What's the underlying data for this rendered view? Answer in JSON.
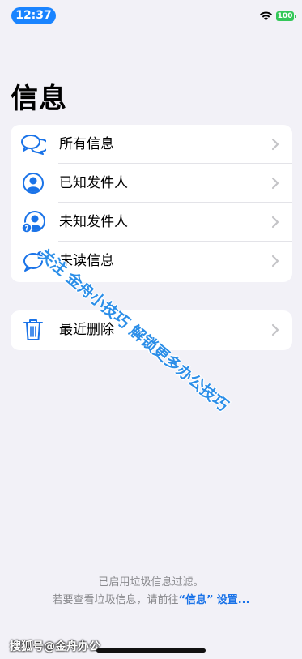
{
  "status": {
    "time": "12:37",
    "battery": "100"
  },
  "page": {
    "title": "信息"
  },
  "filters": [
    {
      "label": "所有信息",
      "icon": "speech-bubbles-icon"
    },
    {
      "label": "已知发件人",
      "icon": "person-circle-icon"
    },
    {
      "label": "未知发件人",
      "icon": "person-question-icon"
    },
    {
      "label": "未读信息",
      "icon": "unread-bubble-icon"
    }
  ],
  "recently_deleted": {
    "label": "最近删除",
    "icon": "trash-icon"
  },
  "footer": {
    "line1": "已启用垃圾信息过滤。",
    "line2_prefix": "若要查看垃圾信息，请前往",
    "line2_link": "“信息”",
    "line2_suffix": "设置..."
  },
  "overlay": {
    "watermark": "关注 金舟小技巧 解锁更多办公技巧",
    "source": "搜狐号@金舟办公"
  },
  "colors": {
    "accent": "#1a84ff",
    "icon_blue": "#1a73e8",
    "background": "#f2f1f7",
    "battery_green": "#34c759"
  }
}
